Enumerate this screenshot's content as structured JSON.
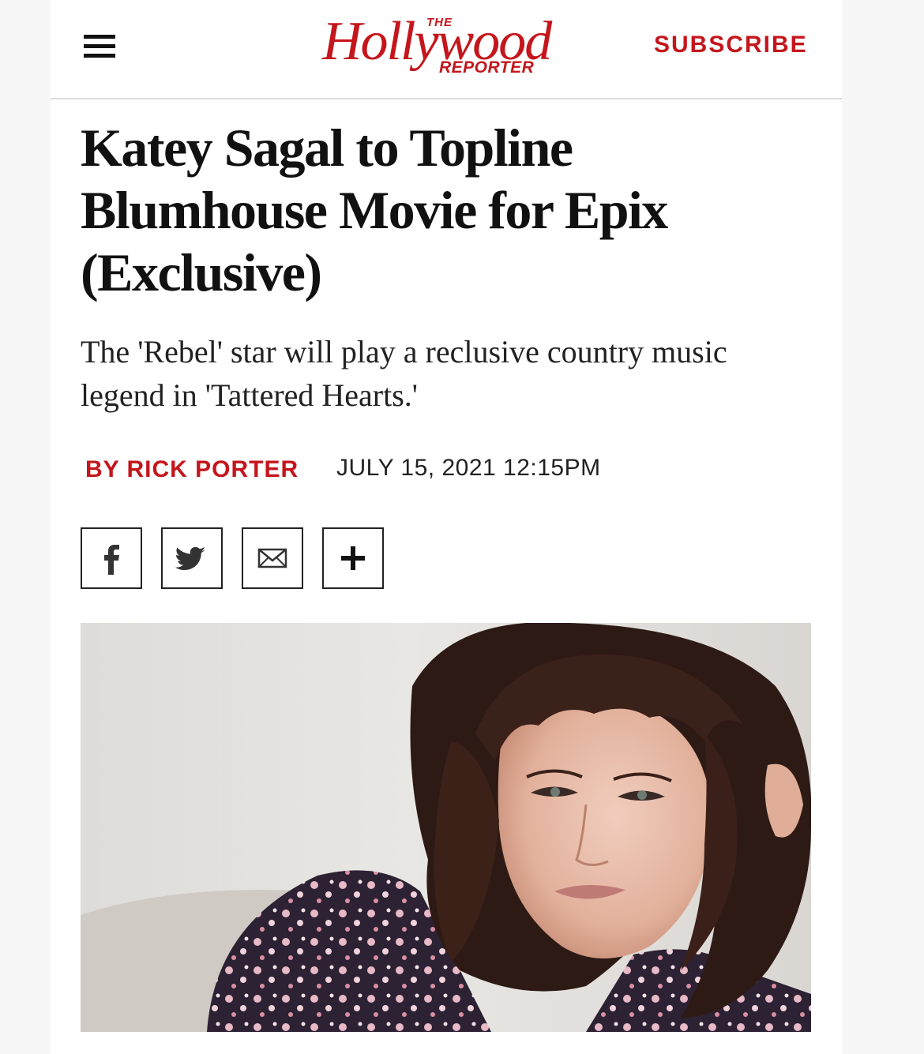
{
  "header": {
    "menu_icon": "hamburger-menu-icon",
    "logo": {
      "the": "THE",
      "wordmark": "Hollywood",
      "reporter": "REPORTER"
    },
    "subscribe_label": "SUBSCRIBE"
  },
  "article": {
    "headline": "Katey Sagal to Topline Blumhouse Movie for Epix (Exclusive)",
    "dek": "The 'Rebel' star will play a reclusive country music legend in 'Tattered Hearts.'",
    "byline": "BY RICK PORTER",
    "dateline": "JULY 15, 2021 12:15PM"
  },
  "share": [
    {
      "icon": "facebook-icon"
    },
    {
      "icon": "twitter-icon"
    },
    {
      "icon": "email-icon"
    },
    {
      "icon": "plus-icon"
    }
  ],
  "colors": {
    "brand_red": "#c4161c",
    "text": "#111111"
  }
}
